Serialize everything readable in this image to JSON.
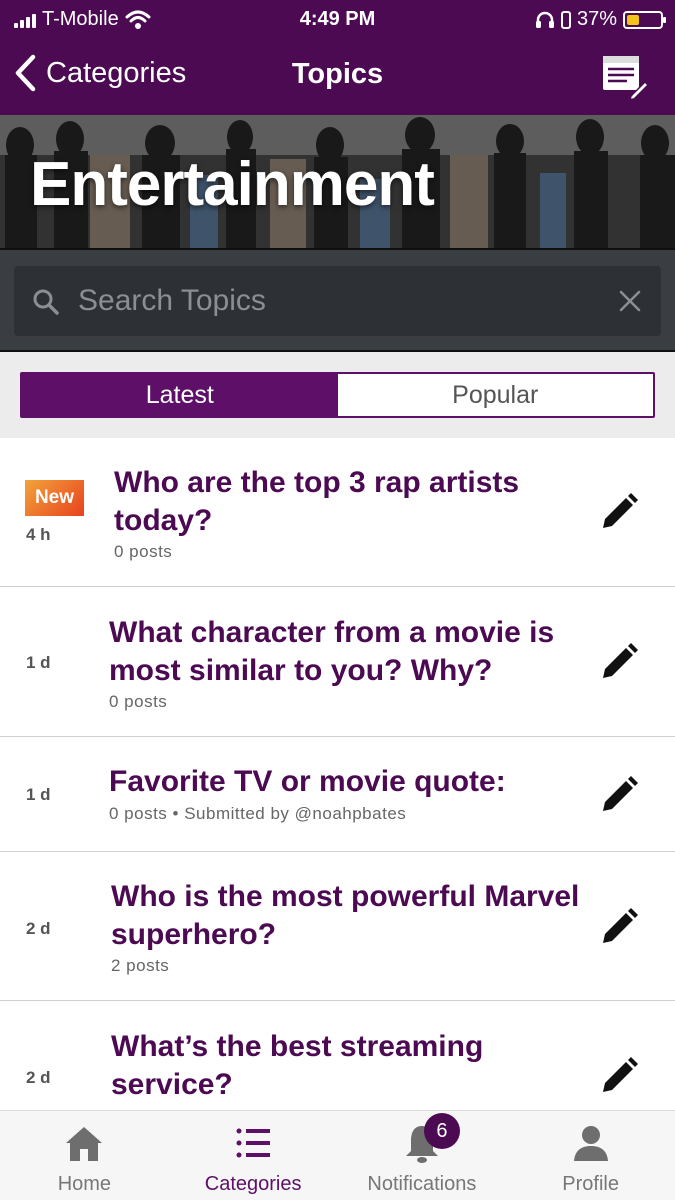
{
  "status": {
    "carrier": "T-Mobile",
    "time": "4:49 PM",
    "battery": "37%",
    "battery_level": 0.37
  },
  "nav": {
    "back_label": "Categories",
    "title": "Topics"
  },
  "banner": {
    "heading": "Entertainment"
  },
  "search": {
    "placeholder": "Search Topics",
    "value": ""
  },
  "tabs": {
    "latest": "Latest",
    "popular": "Popular"
  },
  "topics": [
    {
      "badge": "New",
      "age": "4 h",
      "title": "Who are the top 3 rap artists today?",
      "meta": "0 posts"
    },
    {
      "age": "1 d",
      "title": "What character from a movie is most similar to you? Why?",
      "meta": "0 posts"
    },
    {
      "age": "1 d",
      "title": "Favorite TV or movie quote:",
      "meta": "0 posts • Submitted by @noahpbates"
    },
    {
      "age": "2 d",
      "title": "Who is the most powerful Marvel superhero?",
      "meta": "2 posts"
    },
    {
      "age": "2 d",
      "title": "What’s the best streaming service?",
      "meta": ""
    }
  ],
  "tabbar": {
    "home": "Home",
    "categories": "Categories",
    "notifications": "Notifications",
    "notifications_count": "6",
    "profile": "Profile"
  },
  "colors": {
    "brand": "#4b0a52",
    "accent": "#5e0f68",
    "new_badge": "#ee7a2a"
  }
}
